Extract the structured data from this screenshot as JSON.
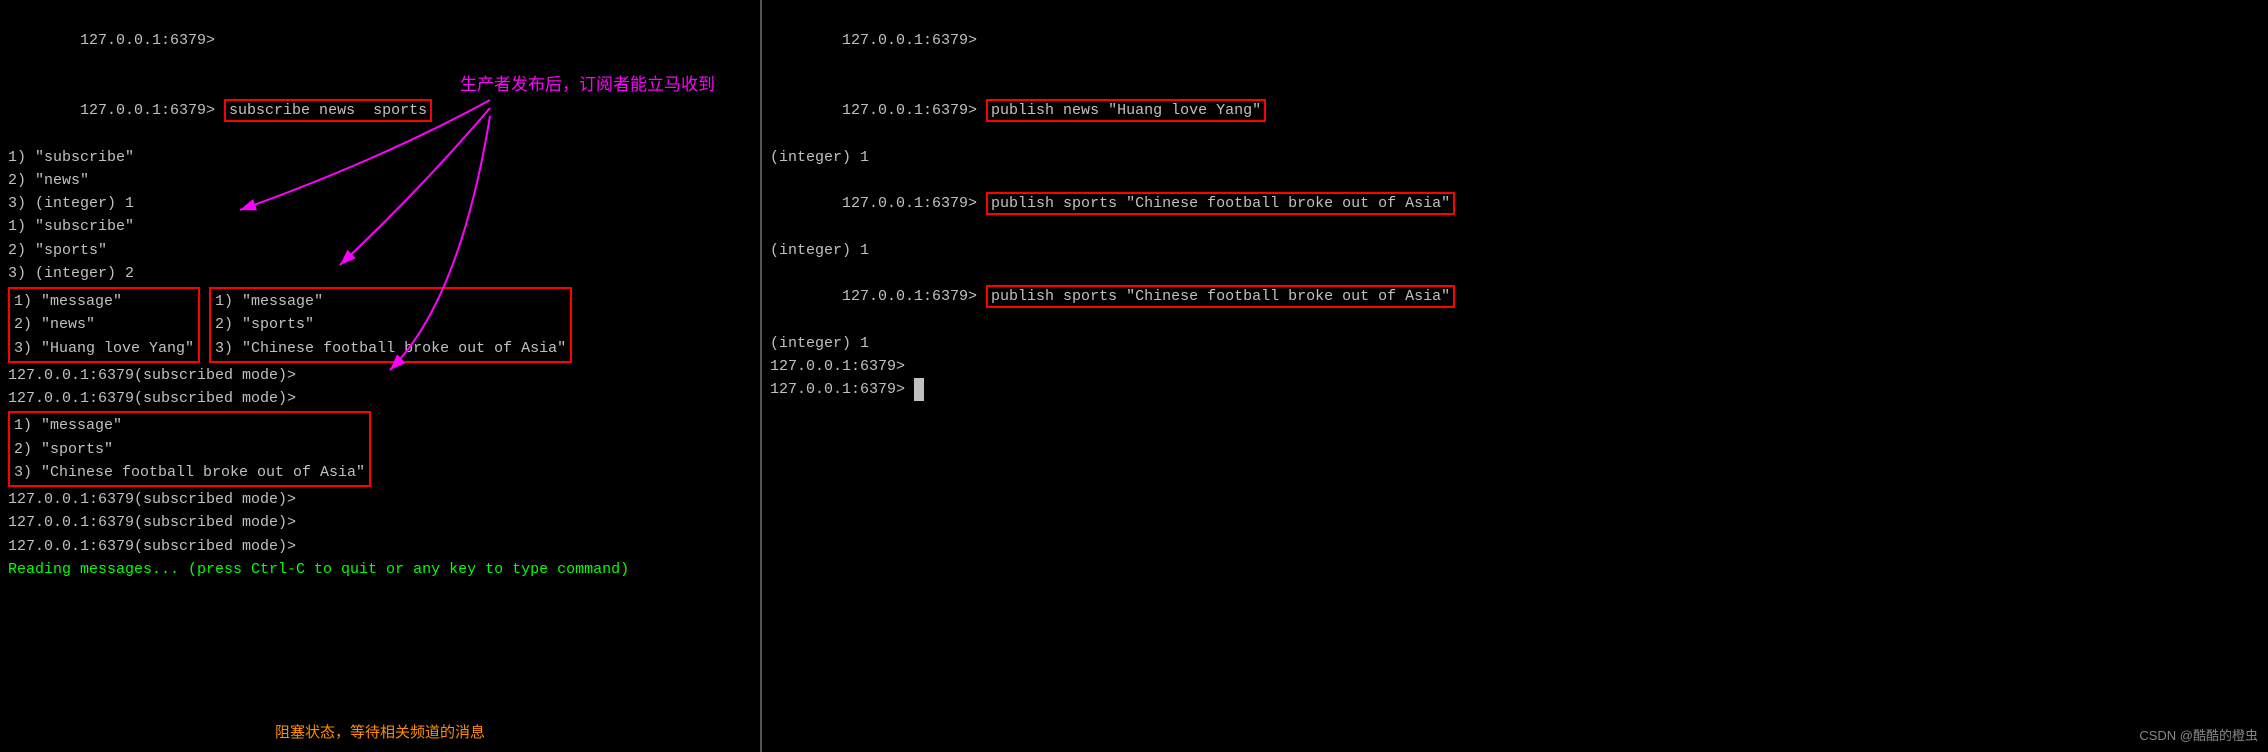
{
  "left": {
    "lines": [
      {
        "type": "prompt",
        "text": "127.0.0.1:6379>"
      },
      {
        "type": "prompt-subscribe",
        "text": "127.0.0.1:6379> subscribe news sports",
        "highlight": true
      },
      {
        "type": "normal",
        "text": "1) \"subscribe\""
      },
      {
        "type": "normal",
        "text": "2) \"news\""
      },
      {
        "type": "normal",
        "text": "3) (integer) 1"
      },
      {
        "type": "normal",
        "text": "1) \"subscribe\""
      },
      {
        "type": "normal",
        "text": "2) \"sports\""
      },
      {
        "type": "normal",
        "text": "3) (integer) 2"
      },
      {
        "type": "message-group-1-start",
        "lines": [
          "1) \"message\"",
          "2) \"news\"",
          "3) \"Huang love Yang\""
        ]
      },
      {
        "type": "message-group-2-start",
        "lines": [
          "1) \"message\"",
          "2) \"sports\"",
          "3) \"Chinese football broke out of Asia\""
        ]
      },
      {
        "type": "normal",
        "text": "127.0.0.1:6379(subscribed mode)>"
      },
      {
        "type": "normal",
        "text": "127.0.0.1:6379(subscribed mode)>"
      },
      {
        "type": "message-group-3-start",
        "lines": [
          "1) \"message\"",
          "2) \"sports\"",
          "3) \"Chinese football broke out of Asia\""
        ]
      },
      {
        "type": "normal",
        "text": "127.0.0.1:6379(subscribed mode)>"
      },
      {
        "type": "normal",
        "text": "127.0.0.1:6379(subscribed mode)>"
      },
      {
        "type": "normal",
        "text": "127.0.0.1:6379(subscribed mode)>"
      },
      {
        "type": "green",
        "text": "Reading messages... (press Ctrl-C to quit or any key to type command)"
      }
    ],
    "annotation_top": "生产者发布后，订阅者能立马收到",
    "annotation_bottom": "阻塞状态，等待相关频道的消息"
  },
  "right": {
    "lines": [
      {
        "type": "prompt",
        "text": "127.0.0.1:6379>"
      },
      {
        "type": "prompt-cmd",
        "text": "127.0.0.1:6379> publish news \"Huang love Yang\"",
        "highlight": true
      },
      {
        "type": "normal",
        "text": "(integer) 1"
      },
      {
        "type": "prompt-cmd",
        "text": "127.0.0.1:6379> publish sports \"Chinese football broke out of Asia\"",
        "highlight": true
      },
      {
        "type": "normal",
        "text": "(integer) 1"
      },
      {
        "type": "prompt-cmd",
        "text": "127.0.0.1:6379> publish sports \"Chinese football broke out of Asia\"",
        "highlight": true
      },
      {
        "type": "normal",
        "text": "(integer) 1"
      },
      {
        "type": "prompt",
        "text": "127.0.0.1:6379>"
      },
      {
        "type": "prompt-cursor",
        "text": "127.0.0.1:6379> "
      }
    ]
  },
  "watermark": "CSDN @酷酷的橙虫"
}
